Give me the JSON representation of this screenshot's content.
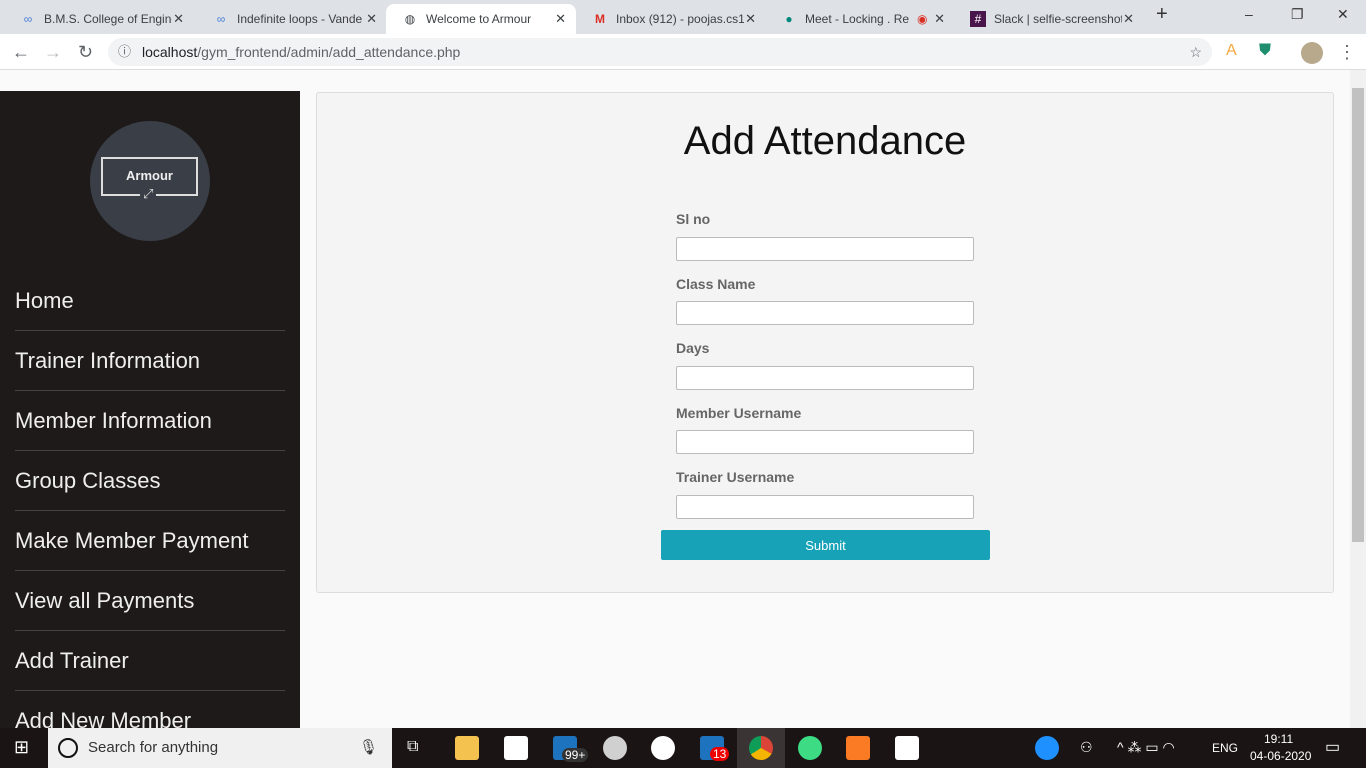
{
  "browser": {
    "tabs": [
      {
        "label": "B.M.S. College of Engine",
        "icon": "infinity-icon"
      },
      {
        "label": "Indefinite loops - Vande",
        "icon": "infinity-icon"
      },
      {
        "label": "Welcome to Armour",
        "icon": "globe-icon",
        "active": true
      },
      {
        "label": "Inbox (912) - poojas.cs1",
        "icon": "gmail-icon"
      },
      {
        "label": "Meet - Locking . Re",
        "icon": "meet-icon"
      },
      {
        "label": "Slack | selfie-screenshot",
        "icon": "slack-icon"
      }
    ],
    "url_host": "localhost",
    "url_path": "/gym_frontend/admin/add_attendance.php"
  },
  "sidebar": {
    "logo_text": "Armour",
    "items": [
      {
        "label": "Home"
      },
      {
        "label": "Trainer Information"
      },
      {
        "label": "Member Information"
      },
      {
        "label": "Group Classes"
      },
      {
        "label": "Make Member Payment"
      },
      {
        "label": "View all Payments"
      },
      {
        "label": "Add Trainer"
      },
      {
        "label": "Add New Member"
      }
    ]
  },
  "main": {
    "title": "Add Attendance",
    "fields": [
      {
        "label": "Sl no",
        "value": ""
      },
      {
        "label": "Class Name",
        "value": ""
      },
      {
        "label": "Days",
        "value": ""
      },
      {
        "label": "Member Username",
        "value": ""
      },
      {
        "label": "Trainer Username",
        "value": ""
      }
    ],
    "submit_label": "Submit",
    "accent": "#17a2b8"
  },
  "taskbar": {
    "search_placeholder": "Search for anything",
    "mail_badge": "99+",
    "whatsapp_badge": "13",
    "lang": "ENG",
    "time": "19:11",
    "date": "04-06-2020"
  }
}
